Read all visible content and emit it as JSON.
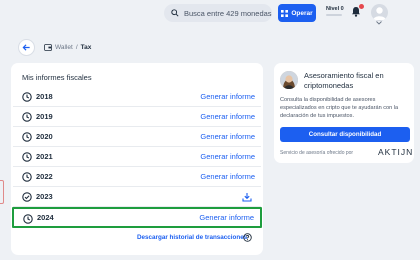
{
  "header": {
    "search_placeholder": "Busca entre 429 monedas",
    "operar_label": "Operar",
    "nivel_label": "Nivel 0"
  },
  "breadcrumb": {
    "section": "Wallet",
    "separator": "/",
    "current": "Tax"
  },
  "reports": {
    "title": "Mis informes fiscales",
    "rows": [
      {
        "year": "2018",
        "action": "Generar informe",
        "status": "pending"
      },
      {
        "year": "2019",
        "action": "Generar informe",
        "status": "pending"
      },
      {
        "year": "2020",
        "action": "Generar informe",
        "status": "pending"
      },
      {
        "year": "2021",
        "action": "Generar informe",
        "status": "pending"
      },
      {
        "year": "2022",
        "action": "Generar informe",
        "status": "pending"
      },
      {
        "year": "2023",
        "action": "",
        "status": "done"
      },
      {
        "year": "2024",
        "action": "Generar informe",
        "status": "pending"
      }
    ],
    "download_link": "Descargar historial de transacciones"
  },
  "advisor": {
    "title": "Asesoramiento fiscal en criptomonedas",
    "description": "Consulta la disponibilidad de asesores especializados en cripto que te ayudarán con la declaración de tus impuestos.",
    "button_label": "Consultar disponibilidad",
    "service_text": "Servicio de asesoría ofrecido por",
    "partner_logo": "AKTIJN"
  },
  "colors": {
    "accent": "#1c5ff0",
    "highlight_border": "#1e9d3e",
    "background": "#eef1f5",
    "card": "#ffffff"
  }
}
